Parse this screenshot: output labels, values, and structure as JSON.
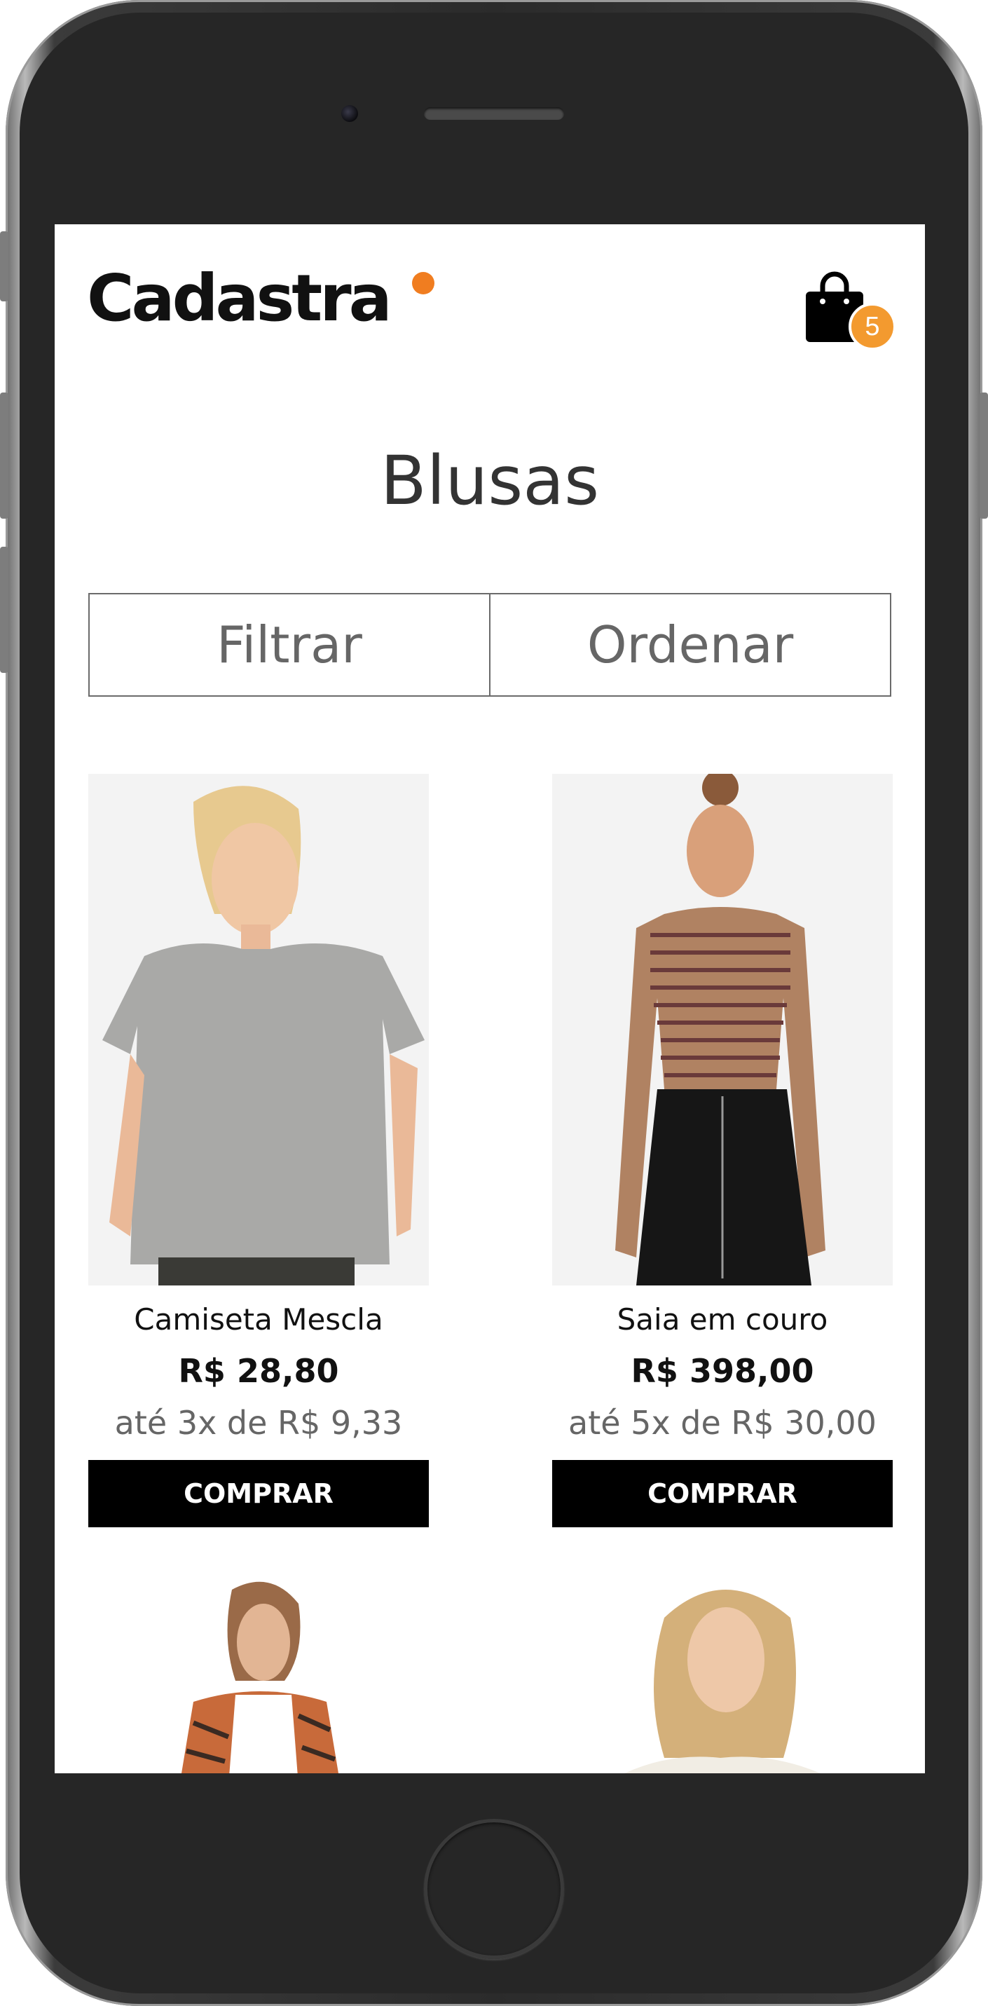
{
  "header": {
    "logo_text": "Cadastra",
    "cart_count": "5",
    "cart_icon": "shopping-bag-icon"
  },
  "page": {
    "title": "Blusas"
  },
  "toolbar": {
    "filter_label": "Filtrar",
    "sort_label": "Ordenar"
  },
  "products": [
    {
      "name": "Camiseta Mescla",
      "price": "R$ 28,80",
      "installments": "até 3x de R$ 9,33",
      "buy_label": "COMPRAR"
    },
    {
      "name": "Saia em couro",
      "price": "R$ 398,00",
      "installments": "até 5x de R$ 30,00",
      "buy_label": "COMPRAR"
    }
  ],
  "colors": {
    "accent": "#f07d20",
    "badge": "#f39a2f",
    "button": "#000000"
  }
}
